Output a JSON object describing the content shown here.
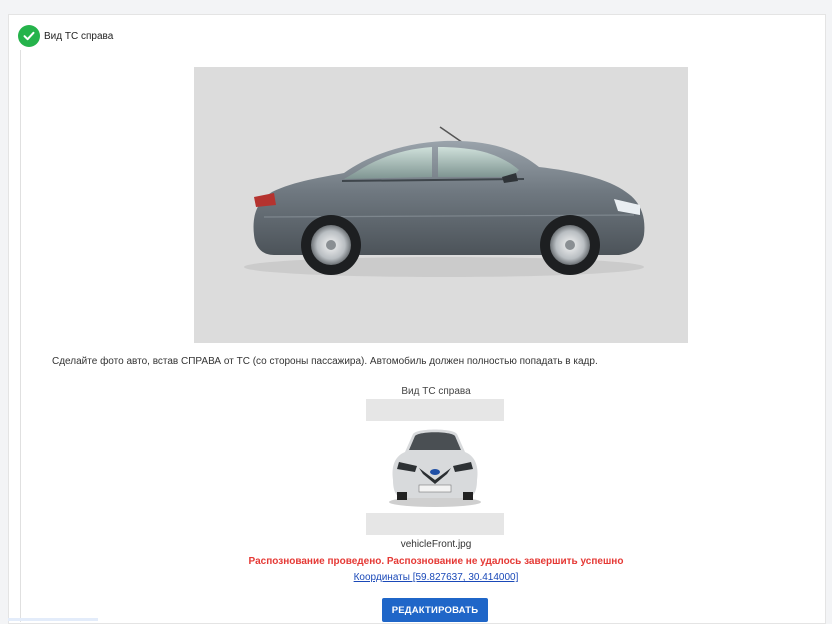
{
  "step": {
    "title": "Вид ТС справа",
    "status_icon": "check-circle-icon",
    "status_color": "#25b34b"
  },
  "example_photo": {
    "subject": "car-side-view",
    "background_color": "#dcdcdc"
  },
  "instruction": "Сделайте фото авто, встав СПРАВА от ТС (со стороны пассажира). Автомобиль должен полностью попадать в кадр.",
  "upload": {
    "caption": "Вид ТС справа",
    "file_name": "vehicleFront.jpg"
  },
  "recognition": {
    "status_text": "Распознование проведено. Распознование не удалось завершить успешно",
    "status_color": "#e53935",
    "coordinates_link": "Координаты [59.827637, 30.414000]"
  },
  "actions": {
    "edit_label": "РЕДАКТИРОВАТЬ",
    "edit_color": "#1f66c8"
  }
}
